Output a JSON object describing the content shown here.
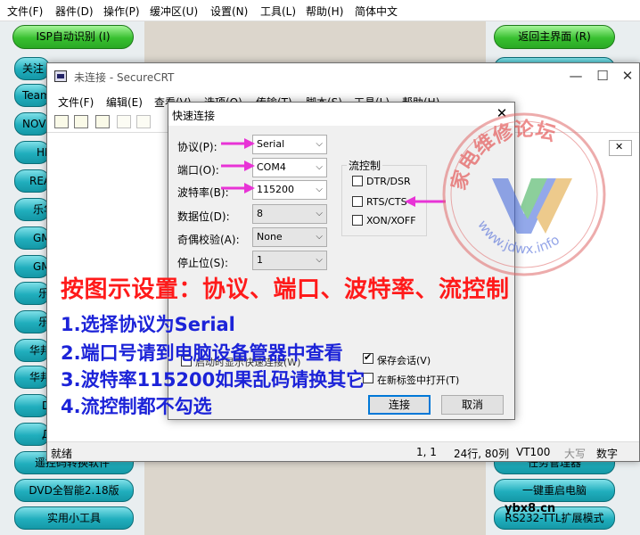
{
  "bg_app": {
    "menu": [
      "文件(F)",
      "器件(D)",
      "操作(P)",
      "缓冲区(U)",
      "设置(N)",
      "工具(L)",
      "帮助(H)",
      "简体中文"
    ],
    "isp_button": "ISP自动识别 (I)",
    "home_button": "返回主界面 (R)",
    "left_buttons": [
      "关注",
      "Team",
      "NOV",
      "HI",
      "REA",
      "乐华",
      "GM",
      "GM",
      "乐",
      "乐",
      "华邦",
      "华邦",
      "D",
      "Д",
      "遥控码转换软件",
      "DVD全智能2.18版",
      "实用小工具"
    ],
    "right_buttons": [
      "任务管理器",
      "一键重启电脑",
      "RS232-TTL扩展模式"
    ]
  },
  "crt": {
    "title": "未连接 - SecureCRT",
    "menu": [
      "文件(F)",
      "编辑(E)",
      "查看(V)",
      "选项(O)",
      "传输(T)",
      "脚本(S)",
      "工具(L)",
      "帮助(H)"
    ],
    "status": {
      "ready": "就绪",
      "position": "1,  1",
      "size": "24行, 80列",
      "terminal": "VT100",
      "caps": "大写",
      "num": "数字"
    }
  },
  "dialog": {
    "title": "快速连接",
    "fields": [
      {
        "label": "协议(P):",
        "value": "Serial"
      },
      {
        "label": "端口(O):",
        "value": "COM4"
      },
      {
        "label": "波特率(B):",
        "value": "115200"
      },
      {
        "label": "数据位(D):",
        "value": "8"
      },
      {
        "label": "奇偶校验(A):",
        "value": "None"
      },
      {
        "label": "停止位(S):",
        "value": "1"
      }
    ],
    "flow_title": "流控制",
    "flow_options": [
      {
        "label": "DTR/DSR",
        "checked": false
      },
      {
        "label": "RTS/CTS",
        "checked": false
      },
      {
        "label": "XON/XOFF",
        "checked": false
      }
    ],
    "startup_option": "启动时显示快速连接(W)",
    "save_session": {
      "label": "保存会话(V)",
      "checked": true
    },
    "new_tab": {
      "label": "在新标签中打开(T)",
      "checked": false
    },
    "connect_button": "连接",
    "cancel_button": "取消"
  },
  "annotation": {
    "headline": "按图示设置：协议、端口、波特率、流控制",
    "lines": [
      "1.选择协议为Serial",
      "2.端口号请到电脑设备管器中查看",
      "3.波特率115200如果乱码请换其它",
      "4.流控制都不勾选"
    ]
  },
  "watermark": {
    "seal_text": "家电维修论坛",
    "seal_url": "www.jdwx.info",
    "corner_text": "ybx8.cn"
  },
  "colors": {
    "annotation_red": "#ff1a1a",
    "annotation_blue": "#1c23d8",
    "arrow_magenta": "#e833d6",
    "green_button": "#38c030",
    "teal_button": "#20aebd"
  }
}
